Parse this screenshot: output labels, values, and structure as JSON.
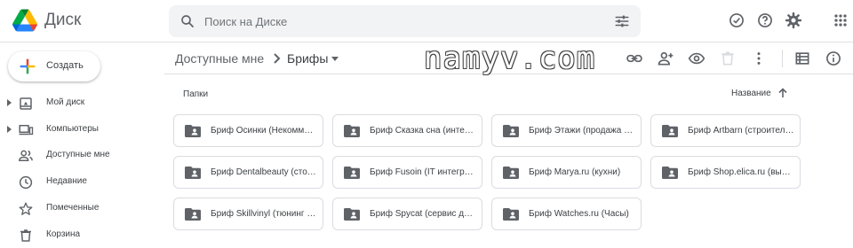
{
  "header": {
    "app_name": "Диск",
    "search_placeholder": "Поиск на Диске"
  },
  "sidebar": {
    "create_label": "Создать",
    "items": [
      {
        "label": "Мой диск",
        "icon": "my-drive-icon"
      },
      {
        "label": "Компьютеры",
        "icon": "computers-icon"
      },
      {
        "label": "Доступные мне",
        "icon": "shared-icon"
      },
      {
        "label": "Недавние",
        "icon": "clock-icon"
      },
      {
        "label": "Помеченные",
        "icon": "star-icon"
      },
      {
        "label": "Корзина",
        "icon": "trash-icon"
      }
    ]
  },
  "toolbar": {
    "breadcrumb_root": "Доступные мне",
    "breadcrumb_current": "Брифы"
  },
  "watermark": "namyv.com",
  "content": {
    "section_label": "Папки",
    "sort_label": "Название",
    "folders": [
      "Бриф Осинки (Некоммерческая организация)",
      "Бриф Сказка сна (интернет-магазин)",
      "Бриф Этажи (продажа недвижимости)",
      "Бриф Artbarn (строительство)",
      "Бриф Dentalbeauty (стоматология)",
      "Бриф Fusoin (IT интеграция)",
      "Бриф Marya.ru (кухни)",
      "Бриф Shop.elica.ru (вытяжки)",
      "Бриф Skillvinyl (тюнинг авто)",
      "Бриф Spycat (сервис для сайтов)",
      "Бриф Watches.ru (Часы)"
    ]
  },
  "colors": {
    "accent_blue": "#1a73e8",
    "icon_gray": "#5f6368",
    "folder_gray": "#5f6368"
  }
}
